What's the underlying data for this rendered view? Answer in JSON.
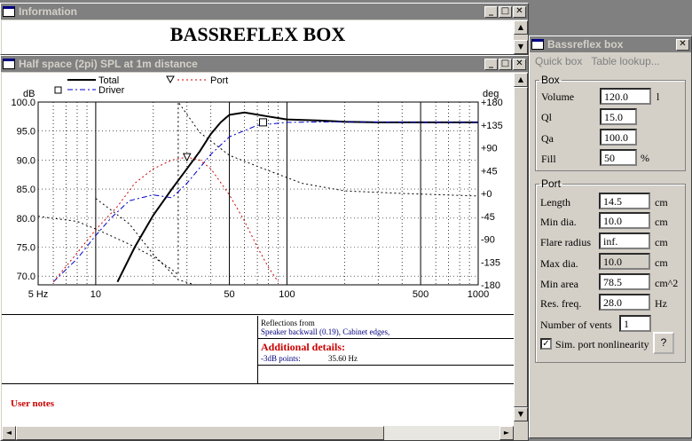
{
  "info_window": {
    "title": "Information",
    "heading": "BASSREFLEX BOX"
  },
  "spl_window": {
    "title": "Half space (2pi) SPL at 1m distance",
    "legend": {
      "total": "Total",
      "driver": "Driver",
      "port": "Port"
    },
    "left_axis_unit": "dB",
    "right_axis_unit": "deg",
    "left_ticks": [
      "100.0",
      "95.0",
      "90.0",
      "85.0",
      "80.0",
      "75.0",
      "70.0"
    ],
    "right_ticks": [
      "+180",
      "+135",
      "+90",
      "+45",
      "+0",
      "-45",
      "-90",
      "-135",
      "-180"
    ],
    "x_ticks": [
      "5 Hz",
      "10",
      "50",
      "100",
      "500",
      "1000"
    ],
    "reflections_title": "Reflections from",
    "reflections_text": "Speaker backwall (0.19), Cabinet edges,",
    "details_title": "Additional details:",
    "detail_label": "-3dB points:",
    "detail_value": "35.60 Hz",
    "user_notes": "User notes"
  },
  "chart_data": {
    "type": "line",
    "title": "Half space (2pi) SPL at 1m distance",
    "x_scale": "log",
    "xlim": [
      5,
      1000
    ],
    "ylim": [
      68.5,
      100
    ],
    "y2lim": [
      -180,
      180
    ],
    "ylabel": "dB",
    "y2label": "deg",
    "series": [
      {
        "name": "Total",
        "style": "solid",
        "color": "#000000",
        "axis": "dB",
        "x": [
          13,
          16,
          20,
          25,
          30,
          35,
          40,
          45,
          50,
          60,
          80,
          100,
          150,
          200,
          300,
          500,
          1000
        ],
        "y": [
          69,
          75,
          80.5,
          85,
          88.5,
          91.5,
          94.5,
          96.5,
          97.8,
          98.2,
          97.5,
          97.0,
          96.8,
          96.6,
          96.5,
          96.5,
          96.5
        ]
      },
      {
        "name": "Driver",
        "style": "dash-dot",
        "color": "#0000cc",
        "axis": "dB",
        "x": [
          6,
          8,
          10,
          12,
          15,
          20,
          25,
          30,
          40,
          50,
          70,
          100,
          200,
          500,
          1000
        ],
        "y": [
          69,
          73,
          77,
          80,
          83,
          84,
          83.5,
          86,
          91,
          94,
          96,
          96.5,
          96.6,
          96.5,
          96.5
        ]
      },
      {
        "name": "Port",
        "style": "dotted",
        "color": "#cc0000",
        "axis": "dB",
        "x": [
          6,
          8,
          10,
          13,
          16,
          20,
          25,
          30,
          35,
          40,
          50,
          60,
          70,
          80,
          90
        ],
        "y": [
          69,
          74,
          78,
          82,
          86,
          88.5,
          90,
          90.5,
          90,
          88.5,
          84,
          79.5,
          75,
          71.5,
          69
        ]
      },
      {
        "name": "Driver phase",
        "style": "dotted",
        "color": "#000000",
        "axis": "deg",
        "x": [
          5,
          8,
          10,
          15,
          20,
          25,
          27,
          27,
          35,
          50,
          80,
          120,
          200,
          400,
          1000
        ],
        "y": [
          -45,
          -55,
          -70,
          -100,
          -125,
          -150,
          -160,
          180,
          120,
          75,
          45,
          20,
          5,
          0,
          -5
        ]
      },
      {
        "name": "Total phase",
        "style": "dotted",
        "color": "#000000",
        "axis": "deg",
        "x": [
          10,
          15,
          20,
          27,
          33
        ],
        "y": [
          -10,
          -60,
          -120,
          -170,
          -180
        ]
      }
    ],
    "markers": [
      {
        "name": "Driver",
        "shape": "square",
        "x": 75,
        "y": 96.5
      },
      {
        "name": "Port",
        "shape": "triangle",
        "x": 30,
        "y": 90.5
      }
    ]
  },
  "panel": {
    "title": "Bassreflex box",
    "tabs": [
      "Quick box",
      "Table lookup..."
    ],
    "box_legend": "Box",
    "box_fields": [
      {
        "label": "Volume",
        "value": "120.0",
        "unit": "l"
      },
      {
        "label": "Ql",
        "value": "15.0",
        "unit": ""
      },
      {
        "label": "Qa",
        "value": "100.0",
        "unit": ""
      },
      {
        "label": "Fill",
        "value": "50",
        "unit": "%"
      }
    ],
    "port_legend": "Port",
    "port_fields": [
      {
        "label": "Length",
        "value": "14.5",
        "unit": "cm"
      },
      {
        "label": "Min dia.",
        "value": "10.0",
        "unit": "cm"
      },
      {
        "label": "Flare radius",
        "value": "inf.",
        "unit": "cm"
      },
      {
        "label": "Max dia.",
        "value": "10.0",
        "unit": "cm"
      },
      {
        "label": "Min area",
        "value": "78.5",
        "unit": "cm^2"
      },
      {
        "label": "Res. freq.",
        "value": "28.0",
        "unit": "Hz"
      }
    ],
    "vents_label": "Number of vents",
    "vents_value": "1",
    "sim_label": "Sim. port nonlinearity",
    "sim_checked": true,
    "help_label": "?"
  }
}
